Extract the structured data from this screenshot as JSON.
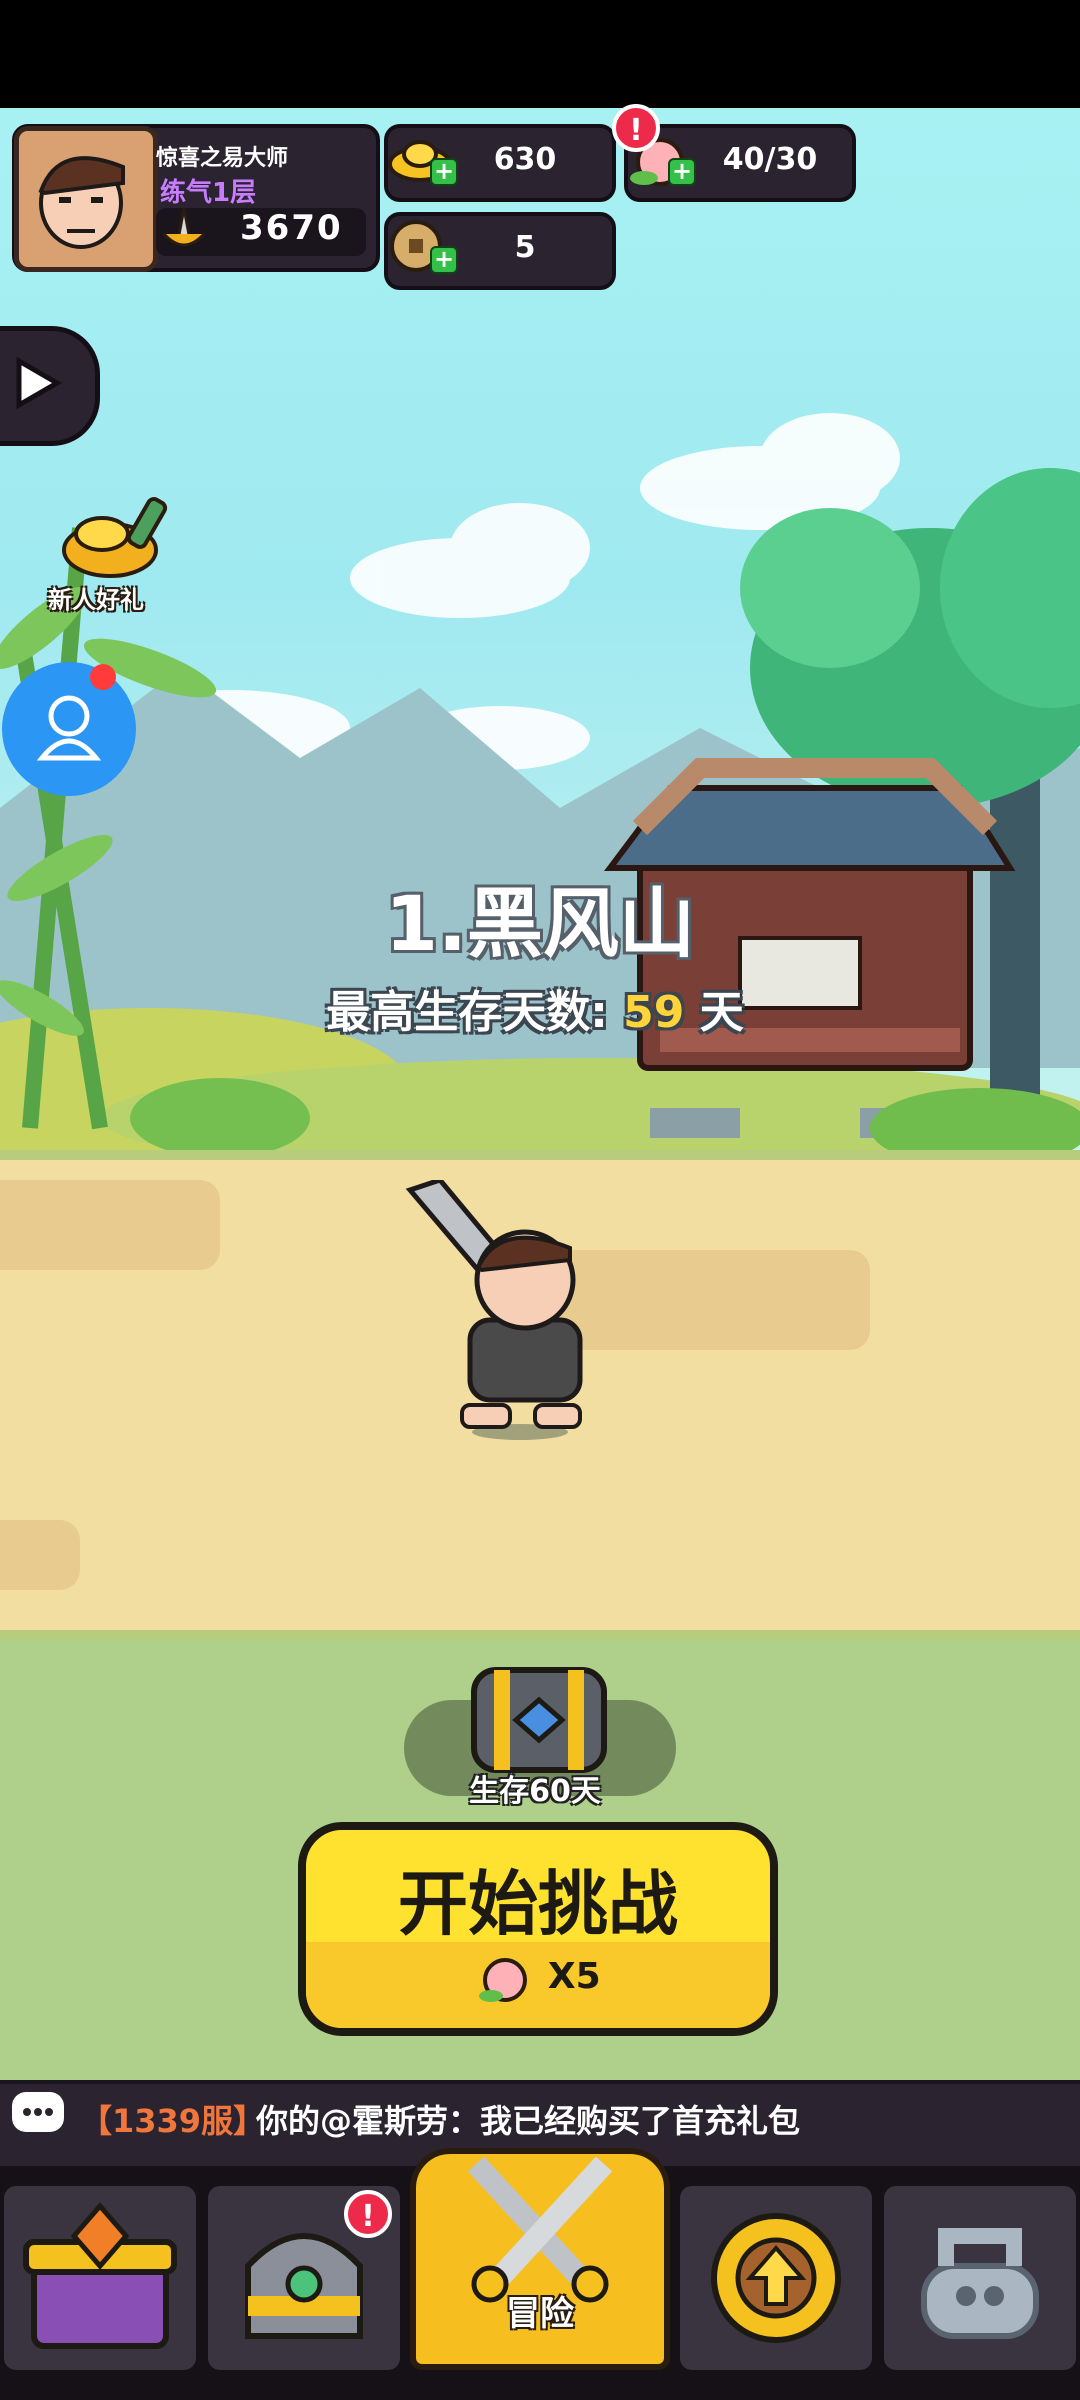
{
  "player": {
    "name": "惊喜之易大师",
    "level": "练气1层",
    "power": "3670"
  },
  "resources": {
    "gold": "630",
    "stamina": "40/30",
    "coins": "5"
  },
  "side": {
    "gift_label": "新人好礼"
  },
  "stage": {
    "title": "1.黑风山",
    "best_label": "最高生存天数: ",
    "best_days": "59",
    "best_unit": " 天"
  },
  "reward": {
    "chest_label": "生存60天"
  },
  "start": {
    "label": "开始挑战",
    "cost": "X5"
  },
  "chat": {
    "server": "【1339服】",
    "message": "你的@霍斯劳：我已经购买了首充礼包"
  },
  "nav": {
    "adventure_label": "冒险",
    "badge": "!"
  },
  "colors": {
    "accent": "#ffe12f",
    "panel": "#2b2430",
    "sky": "#a8f1f3",
    "road": "#f2dea0",
    "grass": "#aed08a"
  }
}
